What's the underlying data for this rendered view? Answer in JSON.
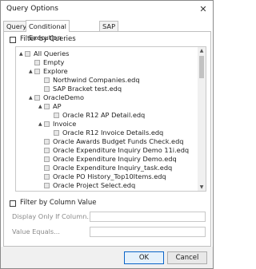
{
  "window": {
    "title": "Query Options",
    "close_glyph": "✕"
  },
  "tabs": [
    {
      "label": "Query",
      "active": false
    },
    {
      "label": "Conditional Execution",
      "active": true
    },
    {
      "label": "SAP",
      "active": false
    }
  ],
  "filter_by_queries": {
    "label": "Filter by Queries",
    "checked": false
  },
  "tree": [
    {
      "label": "All Queries",
      "level": 0,
      "expander": "▲"
    },
    {
      "label": "Empty",
      "level": 1,
      "expander": ""
    },
    {
      "label": "Explore",
      "level": 1,
      "expander": "▲"
    },
    {
      "label": "Northwind Companies.edq",
      "level": 2,
      "expander": ""
    },
    {
      "label": "SAP Bracket test.edq",
      "level": 2,
      "expander": ""
    },
    {
      "label": "OracleDemo",
      "level": 1,
      "expander": "▲"
    },
    {
      "label": "AP",
      "level": 2,
      "expander": "▲"
    },
    {
      "label": "Oracle R12 AP Detail.edq",
      "level": 3,
      "expander": ""
    },
    {
      "label": "Invoice",
      "level": 2,
      "expander": "▲"
    },
    {
      "label": "Oracle R12 Invoice Details.edq",
      "level": 3,
      "expander": ""
    },
    {
      "label": "Oracle Awards Budget Funds Check.edq",
      "level": 2,
      "expander": ""
    },
    {
      "label": "Oracle Expenditure Inquiry Demo 11i.edq",
      "level": 2,
      "expander": ""
    },
    {
      "label": "Oracle Expenditure Inquiry Demo.edq",
      "level": 2,
      "expander": ""
    },
    {
      "label": "Oracle Expenditure Inquiry_task.edq",
      "level": 2,
      "expander": ""
    },
    {
      "label": "Oracle PO History_Top10Items.edq",
      "level": 2,
      "expander": ""
    },
    {
      "label": "Oracle Project Select.edq",
      "level": 2,
      "expander": ""
    }
  ],
  "filter_by_column": {
    "label": "Filter by Column Value",
    "checked": false,
    "display_only_label": "Display Only If Column...",
    "display_only_value": "",
    "value_equals_label": "Value Equals...",
    "value_equals_value": ""
  },
  "buttons": {
    "ok": "OK",
    "cancel": "Cancel"
  }
}
